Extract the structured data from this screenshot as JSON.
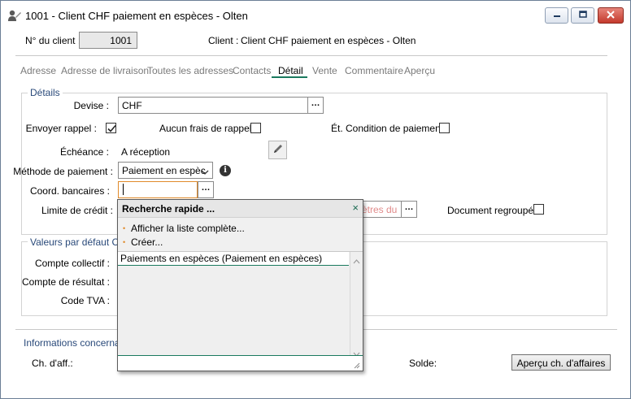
{
  "window": {
    "title": "1001 - Client CHF paiement en espèces - Olten",
    "minimize": "minimize-icon",
    "maximize": "maximize-icon",
    "close": "close-icon"
  },
  "header": {
    "client_no_label": "N° du client :",
    "client_no_value": "1001",
    "client_label": "Client :",
    "client_value": "Client CHF paiement en espèces - Olten"
  },
  "tabs": [
    {
      "label": "Adresse"
    },
    {
      "label": "Adresse de livraison"
    },
    {
      "label": "Toutes les adresses"
    },
    {
      "label": "Contacts"
    },
    {
      "label": "Détail",
      "active": true
    },
    {
      "label": "Vente"
    },
    {
      "label": "Commentaire"
    },
    {
      "label": "Aperçu"
    }
  ],
  "details": {
    "group_title": "Détails",
    "devise_label": "Devise :",
    "devise_value": "CHF",
    "envoyer_rappel_label": "Envoyer rappel :",
    "envoyer_rappel_checked": true,
    "aucun_frais_label": "Aucun frais de rappel :",
    "aucun_frais_checked": false,
    "et_condition_label": "Ét. Condition de paiement :",
    "et_condition_checked": false,
    "echeance_label": "Échéance :",
    "echeance_value": "A réception",
    "methode_label": "Méthode de paiement :",
    "methode_value": "Paiement en espèc",
    "coord_label": "Coord. bancaires :",
    "coord_value": "",
    "limite_label": "Limite de crédit :",
    "limite_partial": "ètres du",
    "doc_regroupe_label": "Document regroupé :",
    "doc_regroupe_checked": false
  },
  "valeurs": {
    "group_title": "Valeurs par défaut Com",
    "compte_collectif_label": "Compte collectif :",
    "compte_resultat_label": "Compte de résultat :",
    "code_tva_label": "Code TVA :"
  },
  "informations": {
    "group_title": "Informations concernant",
    "ch_aff_label": "Ch. d'aff.:",
    "solde_label": "Solde:",
    "apercu_button": "Aperçu ch. d'affaires"
  },
  "popup": {
    "title": "Recherche rapide ...",
    "close": "×",
    "links": [
      "Afficher la liste complète...",
      "Créer..."
    ],
    "rows": [
      "Paiements en espèces (Paiement en espèces)"
    ]
  },
  "colors": {
    "accent": "#1a7a5e",
    "group_title": "#2a4a7a",
    "tab_inactive": "#7a7a7a",
    "limite_partial": "#e08a8a",
    "close_red": "#c4392c"
  }
}
